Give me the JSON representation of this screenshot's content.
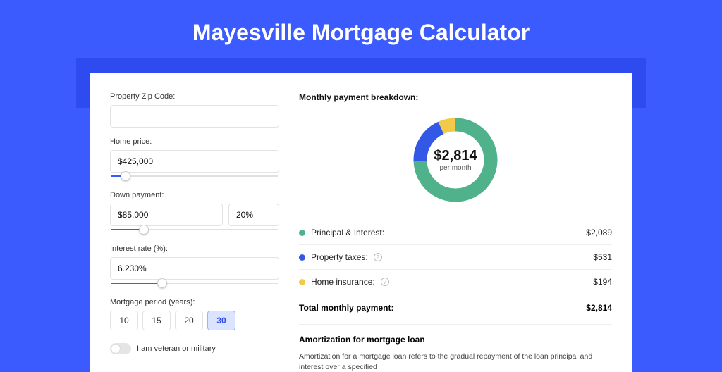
{
  "title": "Mayesville Mortgage Calculator",
  "colors": {
    "principal": "#4fb28b",
    "taxes": "#3358e6",
    "insurance": "#f3c94a"
  },
  "form": {
    "zip_label": "Property Zip Code:",
    "zip_value": "",
    "price_label": "Home price:",
    "price_value": "$425,000",
    "price_slider_pct": 9,
    "down_label": "Down payment:",
    "down_value": "$85,000",
    "down_pct_value": "20%",
    "down_slider_pct": 20,
    "rate_label": "Interest rate (%):",
    "rate_value": "6.230%",
    "rate_slider_pct": 31,
    "period_label": "Mortgage period (years):",
    "periods": [
      "10",
      "15",
      "20",
      "30"
    ],
    "period_selected": "30",
    "veteran_label": "I am veteran or military"
  },
  "breakdown": {
    "title": "Monthly payment breakdown:",
    "center_value": "$2,814",
    "center_sub": "per month",
    "items": [
      {
        "key": "principal",
        "label": "Principal & Interest:",
        "value": "$2,089",
        "info": false,
        "amount": 2089
      },
      {
        "key": "taxes",
        "label": "Property taxes:",
        "value": "$531",
        "info": true,
        "amount": 531
      },
      {
        "key": "insurance",
        "label": "Home insurance:",
        "value": "$194",
        "info": true,
        "amount": 194
      }
    ],
    "total_label": "Total monthly payment:",
    "total_value": "$2,814"
  },
  "amort": {
    "title": "Amortization for mortgage loan",
    "text": "Amortization for a mortgage loan refers to the gradual repayment of the loan principal and interest over a specified"
  },
  "chart_data": {
    "type": "pie",
    "title": "Monthly payment breakdown",
    "series": [
      {
        "name": "Principal & Interest",
        "value": 2089
      },
      {
        "name": "Property taxes",
        "value": 531
      },
      {
        "name": "Home insurance",
        "value": 194
      }
    ],
    "total": 2814,
    "center_label": "$2,814 per month"
  }
}
